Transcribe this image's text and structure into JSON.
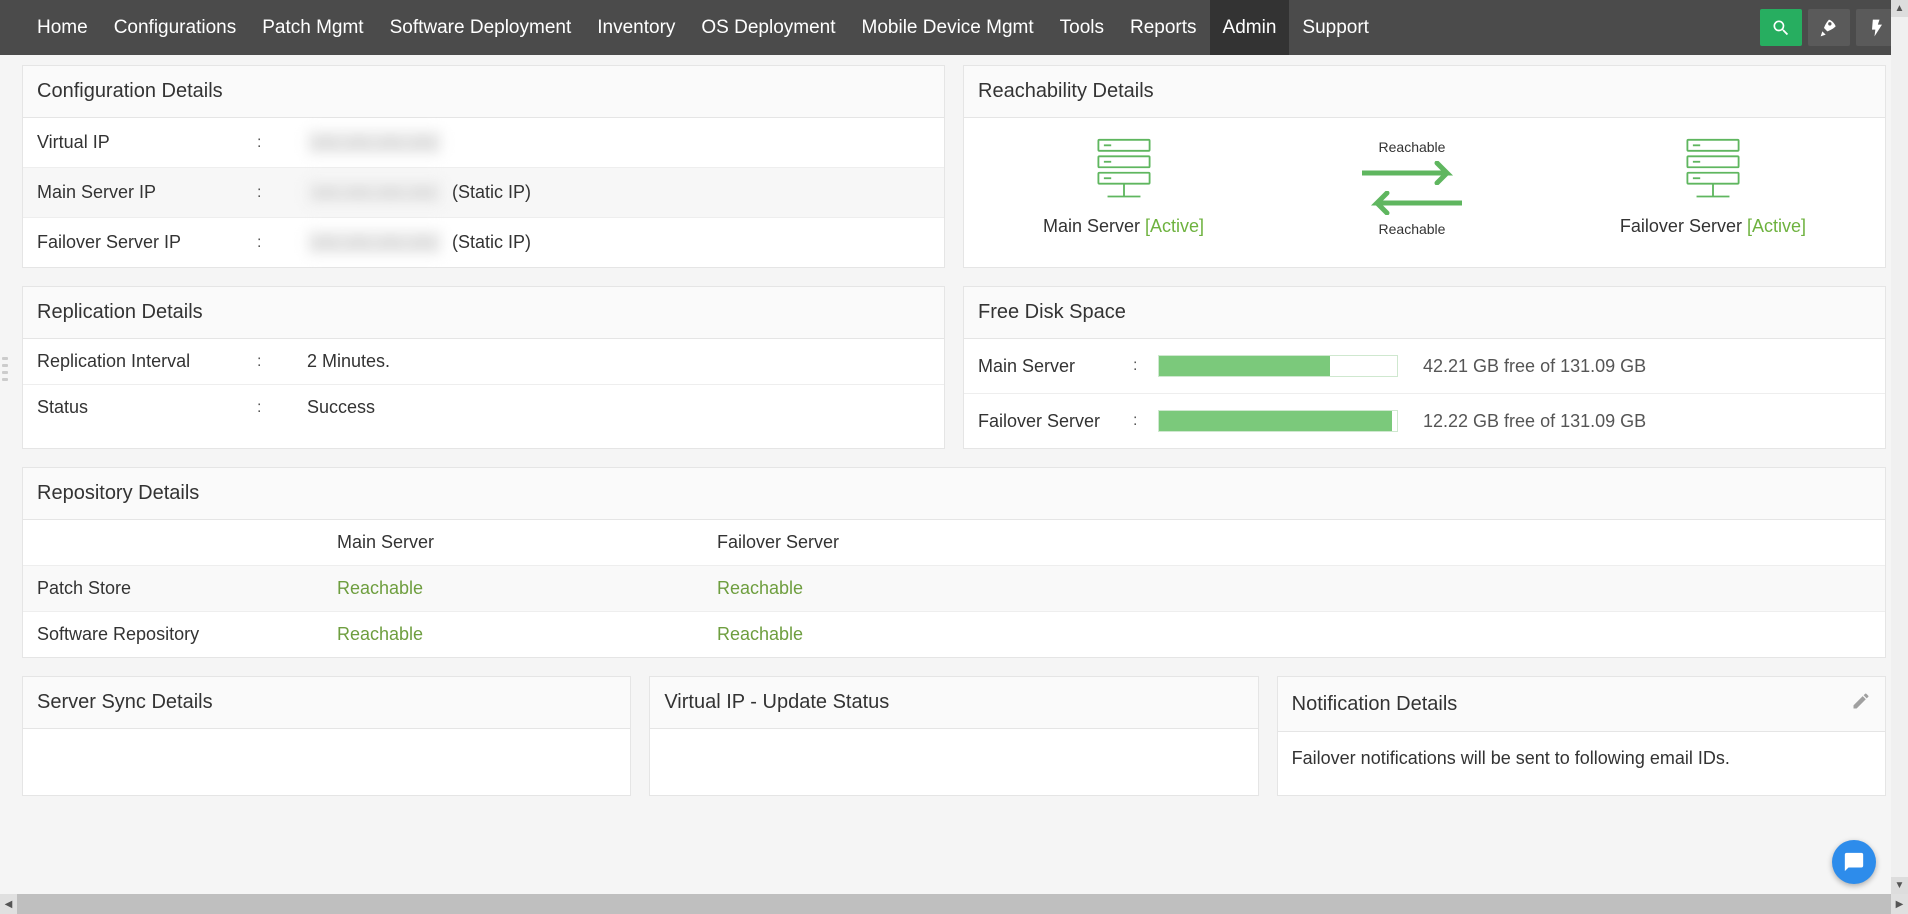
{
  "nav": {
    "items": [
      "Home",
      "Configurations",
      "Patch Mgmt",
      "Software Deployment",
      "Inventory",
      "OS Deployment",
      "Mobile Device Mgmt",
      "Tools",
      "Reports",
      "Admin",
      "Support"
    ],
    "active": 9
  },
  "config_details": {
    "title": "Configuration Details",
    "rows": [
      {
        "label": "Virtual IP",
        "value_hidden": "xxx.xxx.xxx.xxx",
        "suffix": ""
      },
      {
        "label": "Main Server IP",
        "value_hidden": "xxx.xxx.xxx.xxx",
        "suffix": "(Static IP)"
      },
      {
        "label": "Failover Server IP",
        "value_hidden": "xxx.xxx.xxx.xxx",
        "suffix": "(Static IP)"
      }
    ]
  },
  "reach": {
    "title": "Reachability Details",
    "main_label": "Main Server",
    "main_status": "[Active]",
    "failover_label": "Failover Server",
    "failover_status": "[Active]",
    "up_text": "Reachable",
    "down_text": "Reachable"
  },
  "replication": {
    "title": "Replication Details",
    "rows": [
      {
        "label": "Replication Interval",
        "value": "2 Minutes."
      },
      {
        "label": "Status",
        "value": "Success"
      }
    ]
  },
  "disk": {
    "title": "Free Disk Space",
    "rows": [
      {
        "label": "Main Server",
        "free": "42.21 GB free of 131.09 GB",
        "fill_pct": 72
      },
      {
        "label": "Failover Server",
        "free": "12.22 GB free of 131.09 GB",
        "fill_pct": 98
      }
    ]
  },
  "repo": {
    "title": "Repository Details",
    "headers": [
      "",
      "Main Server",
      "Failover Server"
    ],
    "rows": [
      {
        "name": "Patch Store",
        "main": "Reachable",
        "failover": "Reachable"
      },
      {
        "name": "Software Repository",
        "main": "Reachable",
        "failover": "Reachable"
      }
    ]
  },
  "sync": {
    "title": "Server Sync Details"
  },
  "vip": {
    "title": "Virtual IP - Update Status"
  },
  "notif": {
    "title": "Notification Details",
    "body": "Failover notifications will be sent to following email IDs."
  },
  "icons": {
    "search": "search-icon",
    "rocket": "rocket-icon",
    "bolt": "bolt-icon",
    "edit": "edit-icon",
    "chat": "chat-icon"
  }
}
